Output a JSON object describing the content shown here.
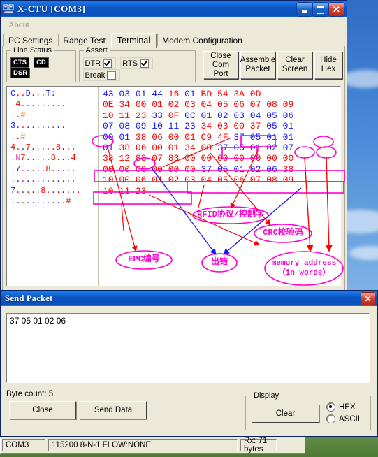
{
  "window": {
    "title": "X-CTU   [COM3]",
    "icon": "app-icon",
    "buttons": {
      "minimize": "_",
      "maximize": "□",
      "close": "✕"
    }
  },
  "menu": {
    "items": [
      "About"
    ]
  },
  "tabs": [
    {
      "label": "PC Settings",
      "active": false
    },
    {
      "label": "Range Test",
      "active": false
    },
    {
      "label": "Terminal",
      "active": true
    },
    {
      "label": "Modem Configuration",
      "active": false
    }
  ],
  "toolbar": {
    "line_status": {
      "legend": "Line Status",
      "leds": [
        "CTS",
        "CD",
        "DSR"
      ]
    },
    "assert": {
      "legend": "Assert",
      "items": [
        {
          "label": "DTR",
          "checked": true
        },
        {
          "label": "RTS",
          "checked": true
        },
        {
          "label": "Break",
          "checked": false
        }
      ]
    },
    "buttons": [
      {
        "line1": "Close",
        "line2": "Com Port"
      },
      {
        "line1": "Assemble",
        "line2": "Packet"
      },
      {
        "line1": "Clear",
        "line2": "Screen"
      },
      {
        "line1": "Hide",
        "line2": "Hex"
      }
    ]
  },
  "terminal": {
    "ascii_lines": [
      "C..D...T:",
      ".4.........",
      "..#",
      "3..........",
      "..#",
      "4..7.....8...",
      ".N7.....8...4",
      ".7.....8.....",
      ".............",
      "7.....8.......",
      "...........#"
    ],
    "hex_rows": [
      [
        "43",
        "03",
        "01",
        "44",
        "16",
        "01",
        "BD",
        "54",
        "3A",
        "0D"
      ],
      [
        "0E",
        "34",
        "00",
        "01",
        "02",
        "03",
        "04",
        "05",
        "06",
        "07",
        "08",
        "09"
      ],
      [
        "10",
        "11",
        "23",
        "33",
        "0F",
        "0C",
        "01",
        "02",
        "03",
        "04",
        "05",
        "06"
      ],
      [
        "07",
        "08",
        "09",
        "10",
        "11",
        "23",
        "34",
        "03",
        "00",
        "37",
        "05",
        "01"
      ],
      [
        "00",
        "01",
        "38",
        "06",
        "00",
        "01",
        "C9",
        "4F",
        "37",
        "05",
        "01",
        "01"
      ],
      [
        "01",
        "38",
        "06",
        "00",
        "01",
        "34",
        "00",
        "37",
        "05",
        "01",
        "02",
        "07"
      ],
      [
        "38",
        "12",
        "83",
        "07",
        "83",
        "00",
        "00",
        "00",
        "00",
        "00",
        "00",
        "00"
      ],
      [
        "00",
        "00",
        "00",
        "00",
        "00",
        "00",
        "37",
        "05",
        "01",
        "02",
        "06",
        "38"
      ],
      [
        "10",
        "00",
        "06",
        "01",
        "02",
        "03",
        "04",
        "05",
        "06",
        "07",
        "08",
        "09"
      ],
      [
        "10",
        "11",
        "23"
      ]
    ]
  },
  "annotations": {
    "labels": [
      {
        "text": "EPC编号"
      },
      {
        "text": "出错"
      },
      {
        "text": "RFID协议/控制字"
      },
      {
        "text": "CRC校验码"
      },
      {
        "text": "memory address",
        "text2": "（in words）"
      }
    ]
  },
  "dialog": {
    "title": "Send Packet",
    "close_label": "✕",
    "packet_value": "37 05 01 02 06",
    "byte_count_label": "Byte count: 5",
    "buttons": {
      "close": "Close",
      "send": "Send Data",
      "clear": "Clear"
    },
    "display": {
      "legend": "Display",
      "options": [
        {
          "label": "HEX",
          "selected": true
        },
        {
          "label": "ASCII",
          "selected": false
        }
      ]
    }
  },
  "statusbar": {
    "port": "COM3",
    "settings": "115200 8-N-1  FLOW:NONE",
    "rx": "Rx: 71 bytes",
    "extra": ""
  }
}
